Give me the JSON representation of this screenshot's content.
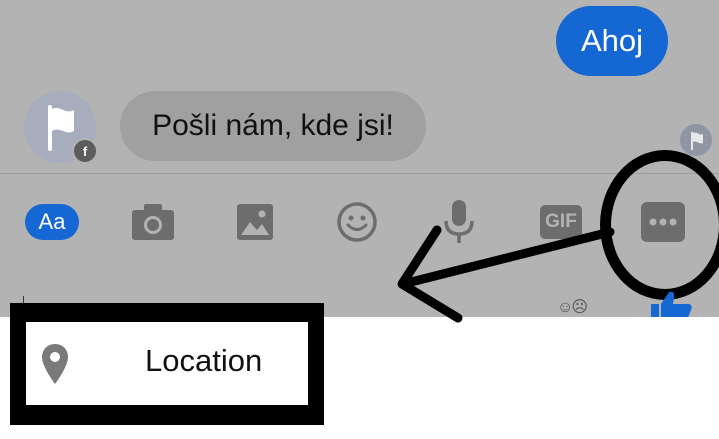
{
  "conversation": {
    "outgoing_message": "Ahoj",
    "incoming_message": "Pošli nám, kde jsi!",
    "avatar_badge": "f"
  },
  "composer": {
    "text_button": "Aa",
    "gif_button": "GIF"
  },
  "menu": {
    "location_label": "Location"
  },
  "colors": {
    "accent": "#1567d3",
    "screen_overlay": "#b3b3b3",
    "annotation": "#000000"
  },
  "icons": [
    "camera-icon",
    "gallery-icon",
    "emoji-icon",
    "microphone-icon",
    "more-icon",
    "thumbs-up-icon",
    "location-pin-icon",
    "flag-icon"
  ]
}
